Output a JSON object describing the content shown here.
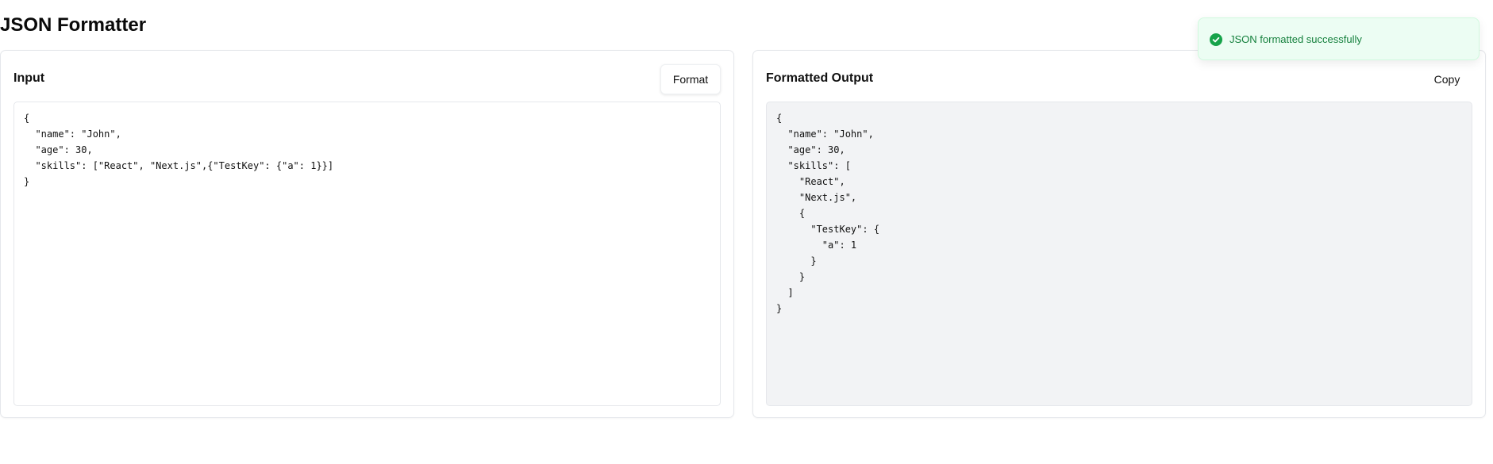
{
  "page": {
    "title": "JSON Formatter"
  },
  "input_panel": {
    "title": "Input",
    "format_label": "Format",
    "value": "{\n  \"name\": \"John\",\n  \"age\": 30,\n  \"skills\": [\"React\", \"Next.js\",{\"TestKey\": {\"a\": 1}}]\n}"
  },
  "output_panel": {
    "title": "Formatted Output",
    "copy_label": "Copy",
    "value": "{\n  \"name\": \"John\",\n  \"age\": 30,\n  \"skills\": [\n    \"React\",\n    \"Next.js\",\n    {\n      \"TestKey\": {\n        \"a\": 1\n      }\n    }\n  ]\n}"
  },
  "toast": {
    "message": "JSON formatted successfully",
    "icon": "check-circle-icon"
  },
  "colors": {
    "toast_background": "#ecfdf3",
    "toast_text": "#15803d",
    "toast_icon": "#16a34a",
    "output_background": "#f2f3f5",
    "panel_border": "#e5e7eb"
  }
}
